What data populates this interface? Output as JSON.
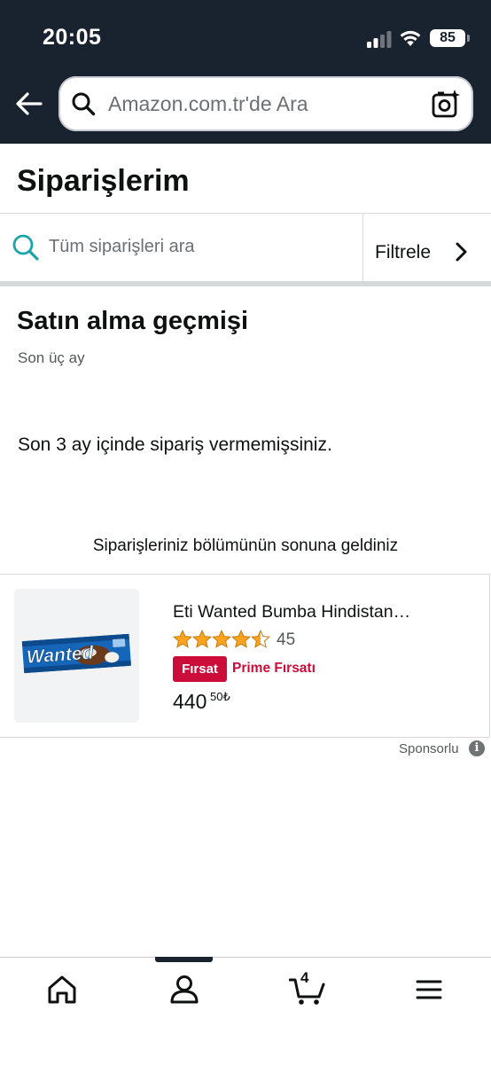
{
  "status_bar": {
    "time": "20:05",
    "battery": "85"
  },
  "search": {
    "placeholder": "Amazon.com.tr'de Ara"
  },
  "page": {
    "title": "Siparişlerim"
  },
  "order_search": {
    "placeholder": "Tüm siparişleri ara",
    "filter_label": "Filtrele"
  },
  "history": {
    "title": "Satın alma geçmişi",
    "subtitle": "Son üç ay",
    "empty_message": "Son 3 ay içinde sipariş vermemişsiniz.",
    "end_message": "Siparişleriniz bölümünün sonuna geldiniz"
  },
  "sponsored_product": {
    "title": "Eti Wanted Bumba Hindistan…",
    "rating": 4.5,
    "rating_count": "45",
    "deal_badge": "Fırsat",
    "deal_text": "Prime Fırsatı",
    "price_whole": "440",
    "price_fraction": "50₺",
    "sponsored_label": "Sponsorlu",
    "image_brand_text": "Wanted"
  },
  "bottom_nav": {
    "items": [
      {
        "icon": "home-icon"
      },
      {
        "icon": "account-icon"
      },
      {
        "icon": "cart-icon",
        "badge": "4"
      },
      {
        "icon": "menu-icon"
      }
    ]
  },
  "colors": {
    "header_bg": "#19222f",
    "deal_red": "#cc0c39",
    "search_teal": "#1aa3a8",
    "star_orange": "#ffa41c"
  }
}
